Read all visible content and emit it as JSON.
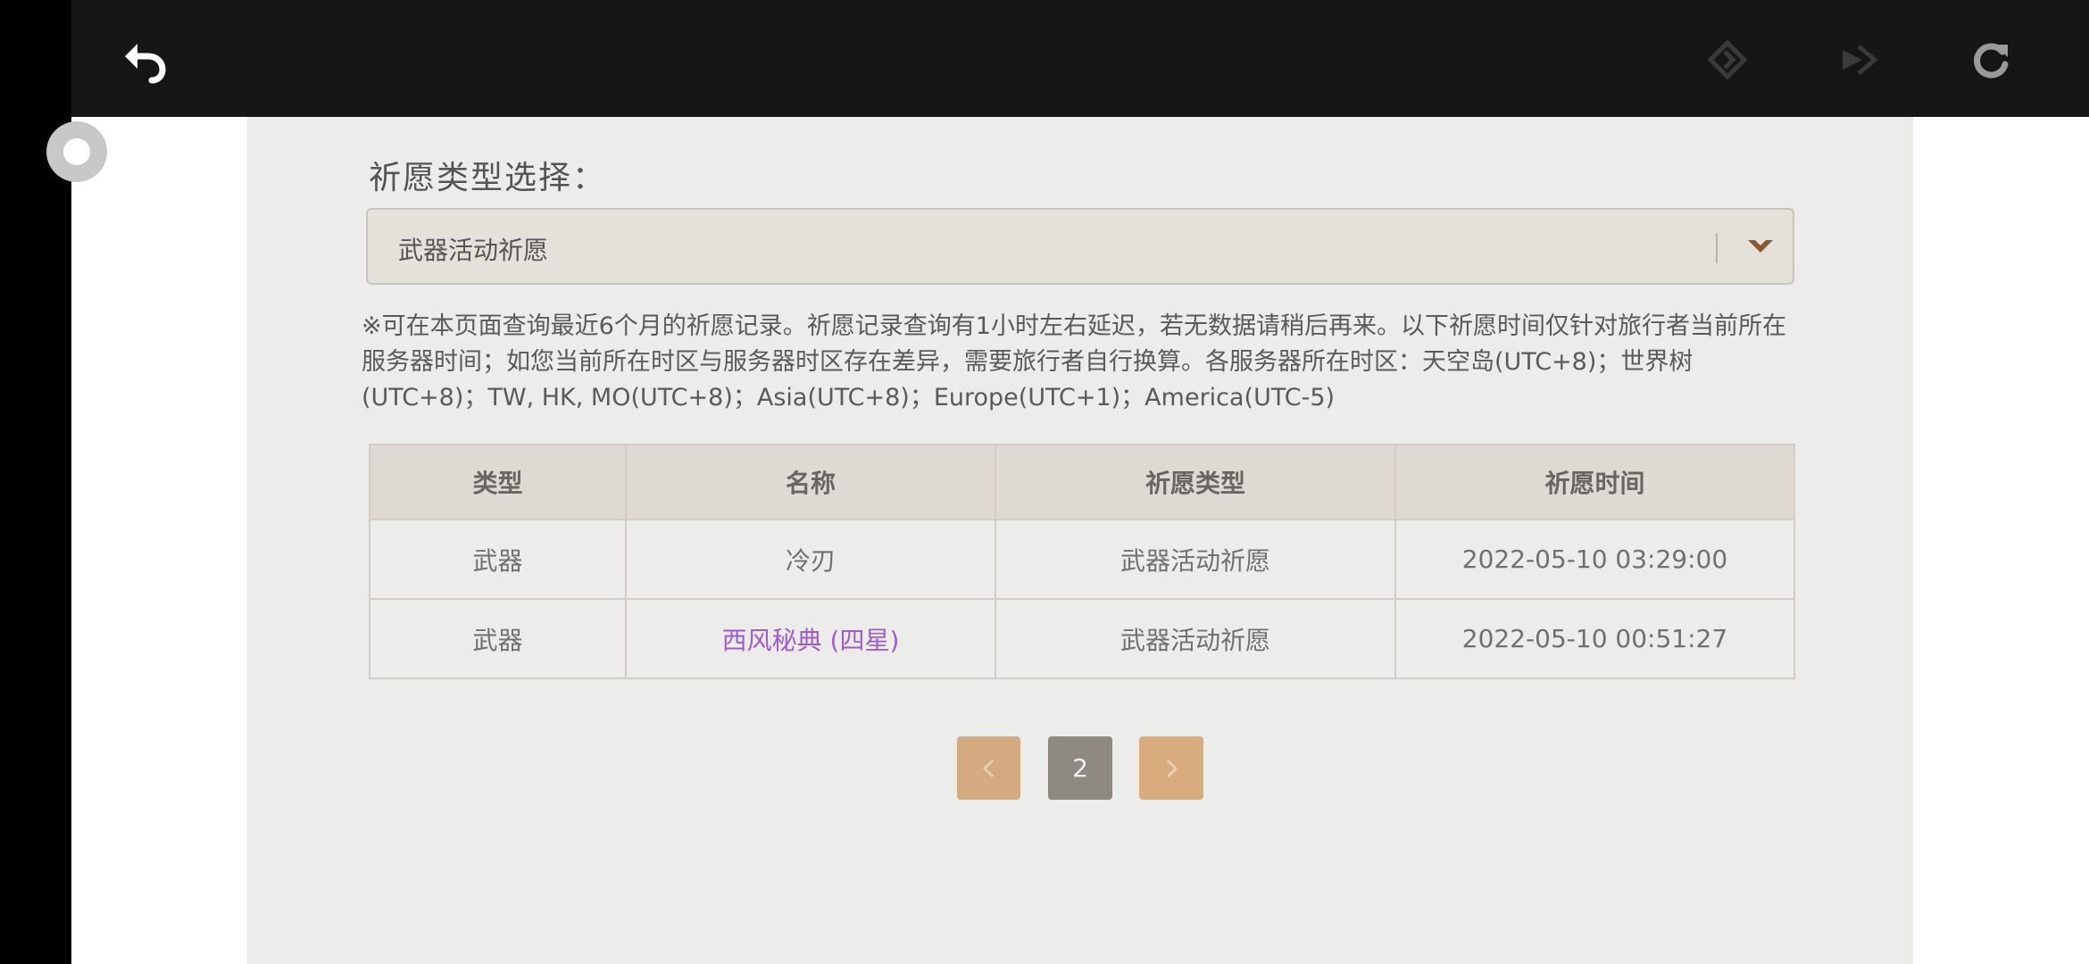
{
  "browser": {
    "icons": [
      "back-arrow-icon",
      "forward-diamond-icon",
      "forward-arrow-icon",
      "refresh-icon"
    ]
  },
  "filter": {
    "label": "祈愿类型选择：",
    "selected": "武器活动祈愿"
  },
  "notice": "※可在本页面查询最近6个月的祈愿记录。祈愿记录查询有1小时左右延迟，若无数据请稍后再来。以下祈愿时间仅针对旅行者当前所在服务器时间；如您当前所在时区与服务器时区存在差异，需要旅行者自行换算。各服务器所在时区：天空岛(UTC+8)；世界树(UTC+8)；TW, HK, MO(UTC+8)；Asia(UTC+8)；Europe(UTC+1)；America(UTC-5)",
  "table": {
    "headers": [
      "类型",
      "名称",
      "祈愿类型",
      "祈愿时间"
    ],
    "rows": [
      [
        "武器",
        "冷刃",
        "武器活动祈愿",
        "2022-05-10 03:29:00"
      ],
      [
        "武器",
        "西风秘典 (四星)",
        "武器活动祈愿",
        "2022-05-10 00:51:27"
      ]
    ]
  },
  "pagination": {
    "current_page": "2"
  },
  "colors": {
    "four_star": "#a05ad2",
    "pager_button": "#d4ab80",
    "current_page_bg": "#8e8981"
  }
}
